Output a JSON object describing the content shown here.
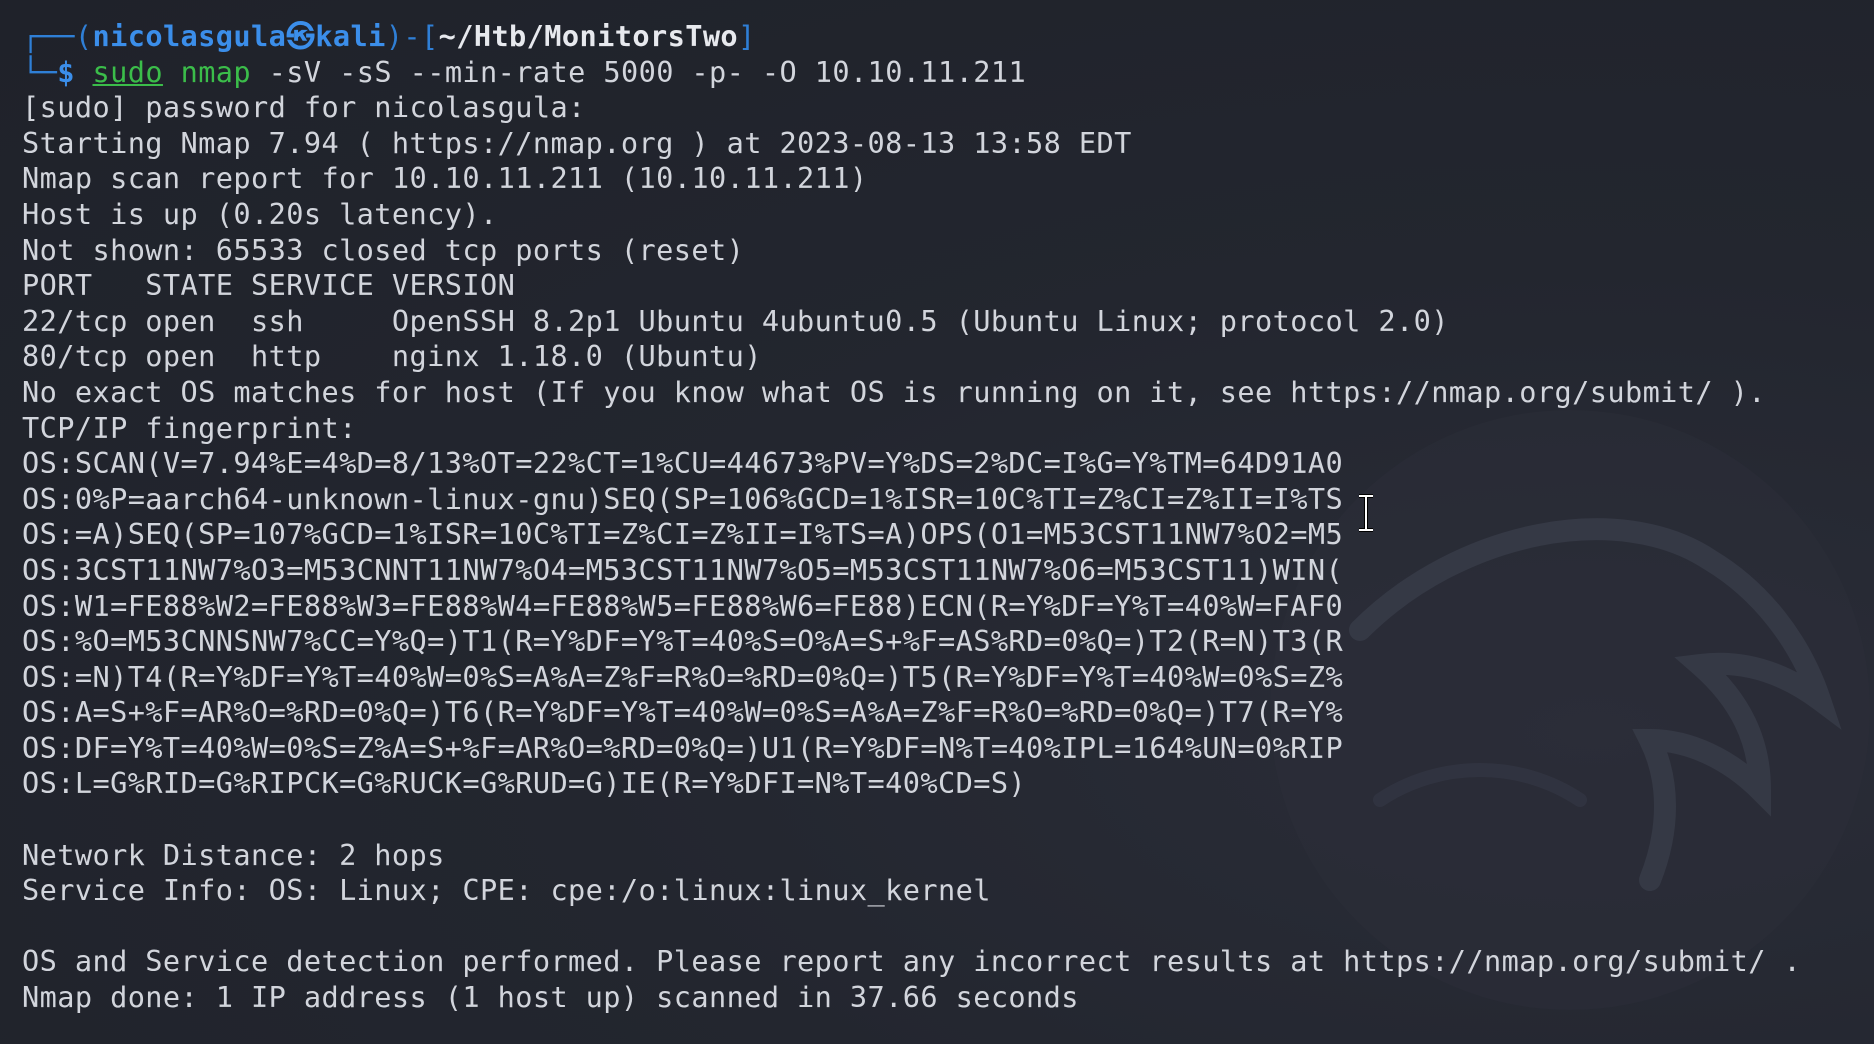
{
  "prompt": {
    "box_top_left": "┌──",
    "open_paren": "(",
    "user": "nicolasgula",
    "at_symbol": "㉿",
    "host": "kali",
    "close_paren": ")",
    "dash": "-",
    "open_bracket": "[",
    "path": "~/Htb/MonitorsTwo",
    "close_bracket": "]",
    "box_bottom_left": "└─",
    "dollar": "$",
    "sudo": "sudo",
    "command": "nmap",
    "args": "-sV -sS --min-rate 5000 -p- -O 10.10.11.211"
  },
  "output": [
    "[sudo] password for nicolasgula:",
    "Starting Nmap 7.94 ( https://nmap.org ) at 2023-08-13 13:58 EDT",
    "Nmap scan report for 10.10.11.211 (10.10.11.211)",
    "Host is up (0.20s latency).",
    "Not shown: 65533 closed tcp ports (reset)",
    "PORT   STATE SERVICE VERSION",
    "22/tcp open  ssh     OpenSSH 8.2p1 Ubuntu 4ubuntu0.5 (Ubuntu Linux; protocol 2.0)",
    "80/tcp open  http    nginx 1.18.0 (Ubuntu)",
    "No exact OS matches for host (If you know what OS is running on it, see https://nmap.org/submit/ ).",
    "TCP/IP fingerprint:",
    "OS:SCAN(V=7.94%E=4%D=8/13%OT=22%CT=1%CU=44673%PV=Y%DS=2%DC=I%G=Y%TM=64D91A0",
    "OS:0%P=aarch64-unknown-linux-gnu)SEQ(SP=106%GCD=1%ISR=10C%TI=Z%CI=Z%II=I%TS",
    "OS:=A)SEQ(SP=107%GCD=1%ISR=10C%TI=Z%CI=Z%II=I%TS=A)OPS(O1=M53CST11NW7%O2=M5",
    "OS:3CST11NW7%O3=M53CNNT11NW7%O4=M53CST11NW7%O5=M53CST11NW7%O6=M53CST11)WIN(",
    "OS:W1=FE88%W2=FE88%W3=FE88%W4=FE88%W5=FE88%W6=FE88)ECN(R=Y%DF=Y%T=40%W=FAF0",
    "OS:%O=M53CNNSNW7%CC=Y%Q=)T1(R=Y%DF=Y%T=40%S=O%A=S+%F=AS%RD=0%Q=)T2(R=N)T3(R",
    "OS:=N)T4(R=Y%DF=Y%T=40%W=0%S=A%A=Z%F=R%O=%RD=0%Q=)T5(R=Y%DF=Y%T=40%W=0%S=Z%",
    "OS:A=S+%F=AR%O=%RD=0%Q=)T6(R=Y%DF=Y%T=40%W=0%S=A%A=Z%F=R%O=%RD=0%Q=)T7(R=Y%",
    "OS:DF=Y%T=40%W=0%S=Z%A=S+%F=AR%O=%RD=0%Q=)U1(R=Y%DF=N%T=40%IPL=164%UN=0%RIP",
    "OS:L=G%RID=G%RIPCK=G%RUCK=G%RUD=G)IE(R=Y%DFI=N%T=40%CD=S)",
    "",
    "Network Distance: 2 hops",
    "Service Info: OS: Linux; CPE: cpe:/o:linux:linux_kernel",
    "",
    "OS and Service detection performed. Please report any incorrect results at https://nmap.org/submit/ .",
    "Nmap done: 1 IP address (1 host up) scanned in 37.66 seconds"
  ],
  "colors": {
    "background": "#22252e",
    "foreground": "#d2d5dc",
    "prompt_blue": "#3b8eea",
    "command_green": "#3bbd4a"
  },
  "icons": {
    "cursor": "text-ibeam-cursor-icon",
    "wallpaper": "kali-dragon-icon"
  }
}
